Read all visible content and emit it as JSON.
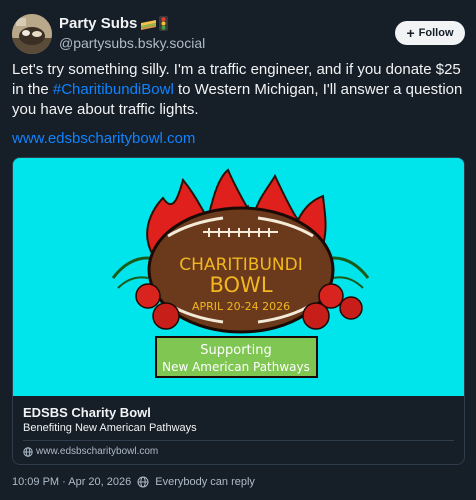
{
  "author": {
    "display_name": "Party Subs",
    "handle": "@partysubs.bsky.social",
    "name_emojis": [
      "sandwich-icon",
      "traffic-light-icon"
    ]
  },
  "follow_button": {
    "label": "Follow"
  },
  "post": {
    "text_before": "Let's try something silly. I'm a traffic engineer, and if you donate $25 in the ",
    "hashtag": "#CharitibundiBowl",
    "text_after": " to Western Michigan, I'll answer a question you have about traffic lights.",
    "link": "www.edsbscharitybowl.com"
  },
  "link_card": {
    "image": {
      "banner_line1": "CHARITIBUNDI",
      "banner_line2": "BOWL",
      "banner_date": "APRIL 20-24 2026",
      "sign_line1": "Supporting",
      "sign_line2": "New American Pathways",
      "background_color": "#00e5ec"
    },
    "title": "EDSBS Charity Bowl",
    "description": "Benefiting New American Pathways",
    "domain": "www.edsbscharitybowl.com"
  },
  "footer": {
    "timestamp": "10:09 PM · Apr 20, 2026",
    "reply_setting": "Everybody can reply"
  }
}
